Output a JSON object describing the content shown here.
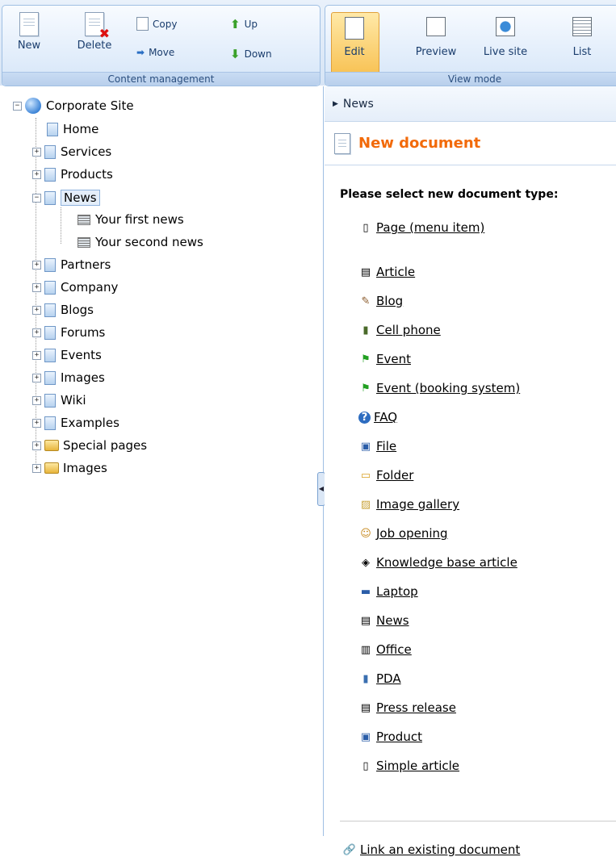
{
  "toolbar": {
    "content_management": {
      "label": "Content management",
      "new": "New",
      "delete": "Delete",
      "copy": "Copy",
      "move": "Move",
      "up": "Up",
      "down": "Down"
    },
    "view_mode": {
      "label": "View mode",
      "edit": "Edit",
      "preview": "Preview",
      "live_site": "Live site",
      "list": "List"
    }
  },
  "tree": {
    "root": "Corporate Site",
    "items": [
      "Home",
      "Services",
      "Products",
      "News",
      "Your first news",
      "Your second news",
      "Partners",
      "Company",
      "Blogs",
      "Forums",
      "Events",
      "Images",
      "Wiki",
      "Examples",
      "Special pages",
      "Images"
    ]
  },
  "breadcrumb": "News",
  "title": "New document",
  "prompt": "Please select new document type:",
  "doc_types": [
    {
      "label": "Page (menu item)",
      "icon": "page-icon"
    },
    {
      "label": "Article",
      "icon": "article-icon"
    },
    {
      "label": "Blog",
      "icon": "blog-icon"
    },
    {
      "label": "Cell phone",
      "icon": "cell-phone-icon"
    },
    {
      "label": "Event",
      "icon": "event-flag-icon"
    },
    {
      "label": "Event (booking system)",
      "icon": "event-booking-icon"
    },
    {
      "label": "FAQ",
      "icon": "faq-icon"
    },
    {
      "label": "File",
      "icon": "file-icon"
    },
    {
      "label": "Folder",
      "icon": "folder-icon"
    },
    {
      "label": "Image gallery",
      "icon": "image-gallery-icon"
    },
    {
      "label": "Job opening",
      "icon": "job-opening-icon"
    },
    {
      "label": "Knowledge base article",
      "icon": "knowledge-base-icon"
    },
    {
      "label": "Laptop",
      "icon": "laptop-icon"
    },
    {
      "label": "News",
      "icon": "news-icon"
    },
    {
      "label": "Office",
      "icon": "office-icon"
    },
    {
      "label": "PDA",
      "icon": "pda-icon"
    },
    {
      "label": "Press release",
      "icon": "press-release-icon"
    },
    {
      "label": "Product",
      "icon": "product-icon"
    },
    {
      "label": "Simple article",
      "icon": "simple-article-icon"
    }
  ],
  "link_existing": "Link an existing document",
  "colors": {
    "accent_orange": "#f26a0a",
    "toolbar_blue": "#d6e4f5",
    "border_blue": "#9fbfe3"
  }
}
